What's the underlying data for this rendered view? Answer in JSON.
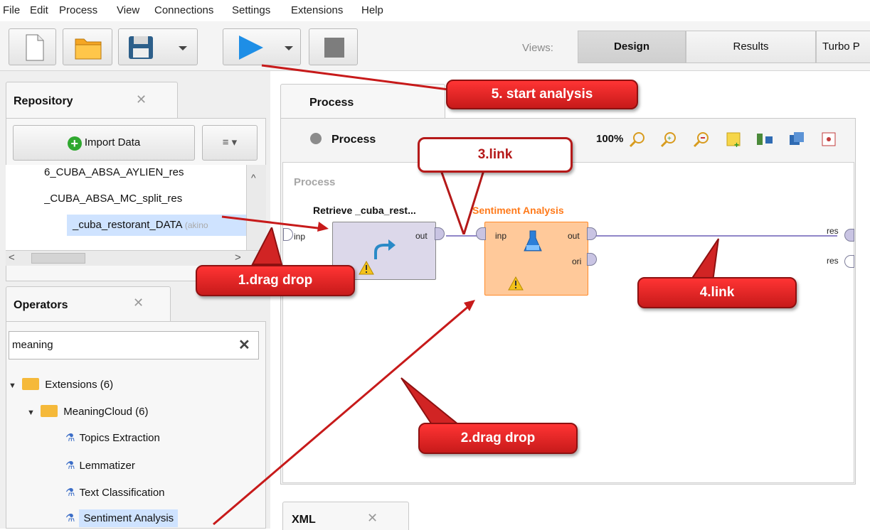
{
  "menu": [
    "File",
    "Edit",
    "Process",
    "View",
    "Connections",
    "Settings",
    "Extensions",
    "Help"
  ],
  "toolbar": {
    "views_label": "Views:",
    "views": [
      "Design",
      "Results",
      "Turbo P"
    ]
  },
  "repository": {
    "tab": "Repository",
    "import_label": "Import Data",
    "menu_glyph": "≡ ▾",
    "items": [
      {
        "label": "6_CUBA_ABSA_AYLIEN_res"
      },
      {
        "label": "_CUBA_ABSA_MC_split_res"
      },
      {
        "label": "_cuba_restorant_DATA",
        "suffix": "(akino"
      }
    ]
  },
  "operators": {
    "tab": "Operators",
    "search_value": "meaning",
    "tree": [
      {
        "label": "Extensions (6)",
        "level": 0
      },
      {
        "label": "MeaningCloud (6)",
        "level": 1
      },
      {
        "label": "Topics Extraction",
        "level": 2
      },
      {
        "label": "Lemmatizer",
        "level": 2
      },
      {
        "label": "Text Classification",
        "level": 2
      },
      {
        "label": "Sentiment Analysis",
        "level": 2
      }
    ]
  },
  "process": {
    "tab": "Process",
    "breadcrumb": "Process",
    "zoom": "100%",
    "canvas_label": "Process",
    "retrieve_title": "Retrieve _cuba_rest...",
    "sentiment_title": "Sentiment Analysis",
    "ports": {
      "inp": "inp",
      "out": "out",
      "ori": "ori",
      "res": "res"
    }
  },
  "xml_tab": "XML",
  "callouts": {
    "start": "5. start analysis",
    "link3": "3.link",
    "drag1": "1.drag drop",
    "link4": "4.link",
    "drag2": "2.drag drop"
  },
  "colors": {
    "accent_red": "#cc1e1e",
    "sentiment_orange": "#ff7a1a",
    "selection": "#cfe3ff"
  }
}
